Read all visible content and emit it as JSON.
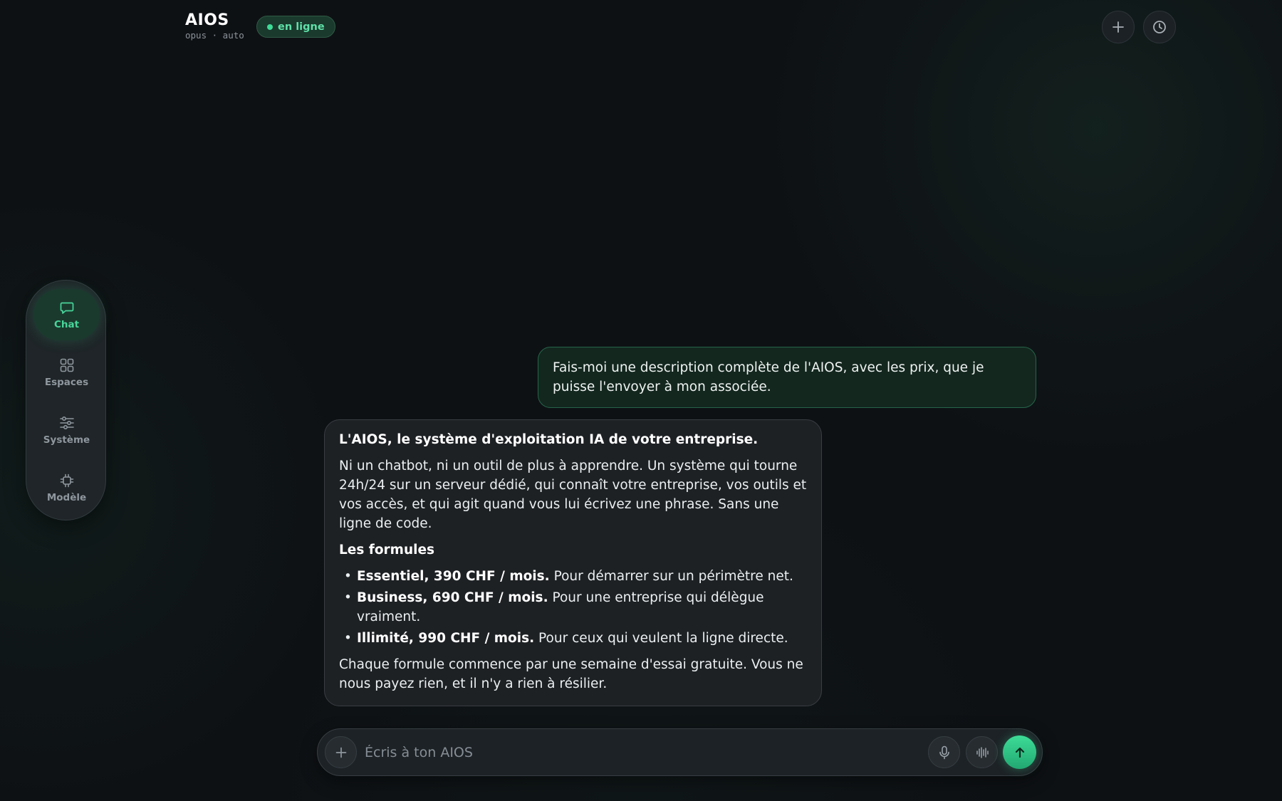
{
  "header": {
    "title": "AIOS",
    "subtitle": "opus · auto",
    "status": "en ligne",
    "new_icon": "plus-icon",
    "history_icon": "clock-icon"
  },
  "nav": {
    "items": [
      {
        "label": "Chat",
        "icon": "chat-bubble-icon",
        "active": true
      },
      {
        "label": "Espaces",
        "icon": "grid-icon",
        "active": false
      },
      {
        "label": "Système",
        "icon": "sliders-icon",
        "active": false
      },
      {
        "label": "Modèle",
        "icon": "chip-icon",
        "active": false
      }
    ]
  },
  "chat": {
    "user_message": "Fais-moi une description complète de l'AIOS, avec les prix, que je puisse l'envoyer à mon associée.",
    "assistant": {
      "heading": "L'AIOS, le système d'exploitation IA de votre entreprise.",
      "intro": "Ni un chatbot, ni un outil de plus à apprendre. Un système qui tourne 24h/24 sur un serveur dédié, qui connaît votre entreprise, vos outils et vos accès, et qui agit quand vous lui écrivez une phrase. Sans une ligne de code.",
      "plans_heading": "Les formules",
      "plans": [
        {
          "name": "Essentiel, 390 CHF / mois.",
          "desc": "Pour démarrer sur un périmètre net."
        },
        {
          "name": "Business, 690 CHF / mois.",
          "desc": "Pour une entreprise qui délègue vraiment."
        },
        {
          "name": "Illimité, 990 CHF / mois.",
          "desc": "Pour ceux qui veulent la ligne directe."
        }
      ],
      "footer": "Chaque formule commence par une semaine d'essai gratuite. Vous ne nous payez rien, et il n'y a rien à résilier."
    }
  },
  "composer": {
    "placeholder": "Écris à ton AIOS",
    "value": "",
    "attach_icon": "plus-icon",
    "mic_icon": "microphone-icon",
    "voice_icon": "waveform-icon",
    "send_icon": "arrow-up-icon"
  },
  "colors": {
    "accent": "#3ddc97",
    "background": "#0e1114",
    "user_bubble": "#13271f",
    "assistant_bubble": "#1e2124"
  }
}
